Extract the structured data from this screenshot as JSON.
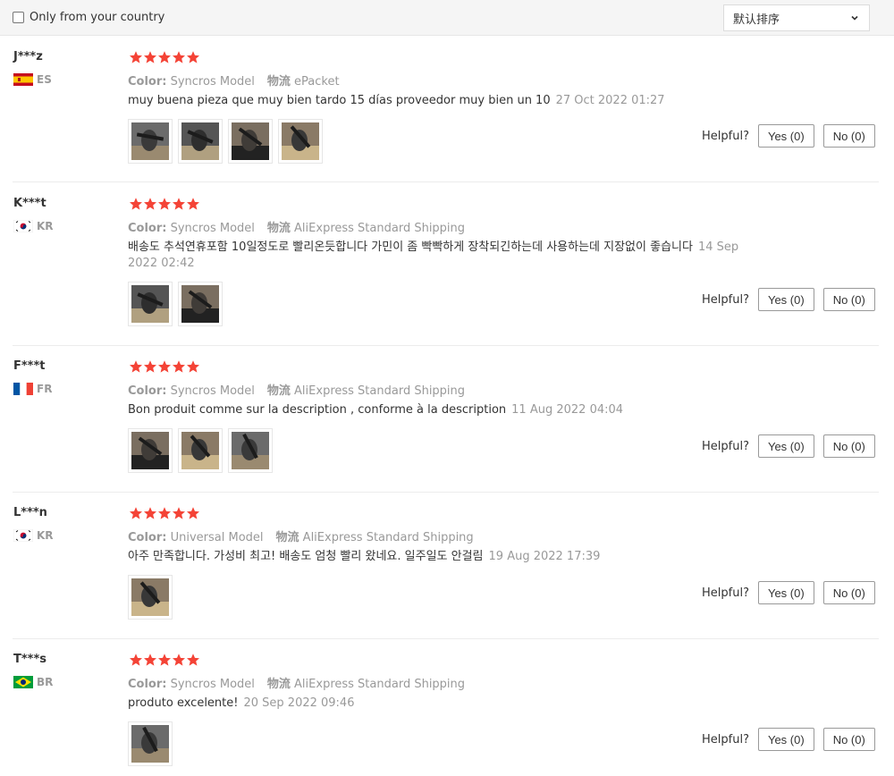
{
  "filter": {
    "country_label": "Only from your country",
    "sort_value": "默认排序"
  },
  "helpful_label": "Helpful?",
  "colors": {
    "star": "#f44336",
    "meta": "#999999"
  },
  "reviews": [
    {
      "user": "J***z",
      "country": "ES",
      "rating": 5,
      "color_label": "Color:",
      "color_value": "Syncros Model",
      "shipping_label": "物流",
      "shipping_value": "ePacket",
      "comment": "muy buena pieza que muy bien tardo 15 días proveedor muy bien un 10",
      "date": "27 Oct 2022 01:27",
      "images": 4,
      "yes": "Yes (0)",
      "no": "No (0)"
    },
    {
      "user": "K***t",
      "country": "KR",
      "rating": 5,
      "color_label": "Color:",
      "color_value": "Syncros Model",
      "shipping_label": "物流",
      "shipping_value": "AliExpress Standard Shipping",
      "comment": "배송도 추석연휴포함 10일정도로 빨리온듯합니다 가민이 좀 빡빡하게 장착되긴하는데 사용하는데 지장없이 좋습니다",
      "date": "14 Sep 2022 02:42",
      "images": 2,
      "yes": "Yes (0)",
      "no": "No (0)"
    },
    {
      "user": "F***t",
      "country": "FR",
      "rating": 5,
      "color_label": "Color:",
      "color_value": "Syncros Model",
      "shipping_label": "物流",
      "shipping_value": "AliExpress Standard Shipping",
      "comment": "Bon produit comme sur la description , conforme à la description",
      "date": "11 Aug 2022 04:04",
      "images": 3,
      "yes": "Yes (0)",
      "no": "No (0)"
    },
    {
      "user": "L***n",
      "country": "KR",
      "rating": 5,
      "color_label": "Color:",
      "color_value": "Universal Model",
      "shipping_label": "物流",
      "shipping_value": "AliExpress Standard Shipping",
      "comment": "아주 만족합니다. 가성비 최고! 배송도 엄청 빨리 왔네요. 일주일도 안걸림",
      "date": "19 Aug 2022 17:39",
      "images": 1,
      "yes": "Yes (0)",
      "no": "No (0)"
    },
    {
      "user": "T***s",
      "country": "BR",
      "rating": 5,
      "color_label": "Color:",
      "color_value": "Syncros Model",
      "shipping_label": "物流",
      "shipping_value": "AliExpress Standard Shipping",
      "comment": "produto excelente!",
      "date": "20 Sep 2022 09:46",
      "images": 1,
      "yes": "Yes (0)",
      "no": "No (0)"
    }
  ]
}
